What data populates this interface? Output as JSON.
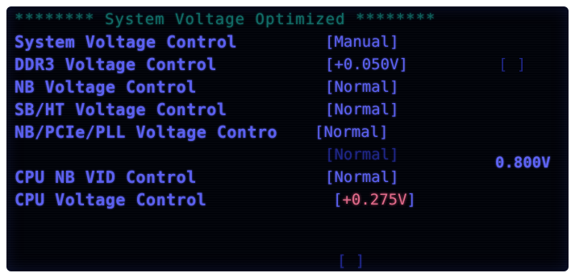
{
  "bios": {
    "title_stars_left": "********",
    "title": "System Voltage Optimized",
    "title_stars_right": "********",
    "rows": [
      {
        "label": "System Voltage Control",
        "value": "[Manual]"
      },
      {
        "label": "DDR3 Voltage Control",
        "value": "[+0.050V]",
        "extra": "[ ]"
      },
      {
        "label": "NB Voltage Control",
        "value": "[Normal]"
      },
      {
        "label": "SB/HT Voltage Control",
        "value": "[Normal]"
      },
      {
        "label": "NB/PCIe/PLL Voltage Contro",
        "value": "[Normal]"
      },
      {
        "label": "",
        "value": "[Normal]",
        "extra": "0.800V"
      },
      {
        "label": "CPU NB VID Control",
        "value": "[Normal]"
      },
      {
        "label": "CPU Voltage Control",
        "value_prefix": "[",
        "value_red": "+0.275V",
        "value_suffix": "]"
      },
      {
        "label": "",
        "value": "[ ]"
      }
    ]
  },
  "colors": {
    "background": "#000208",
    "text": "#5a5ff0",
    "dim_text": "#1d2486",
    "title": "#0f6b66",
    "highlight_red": "#e26a8a"
  }
}
